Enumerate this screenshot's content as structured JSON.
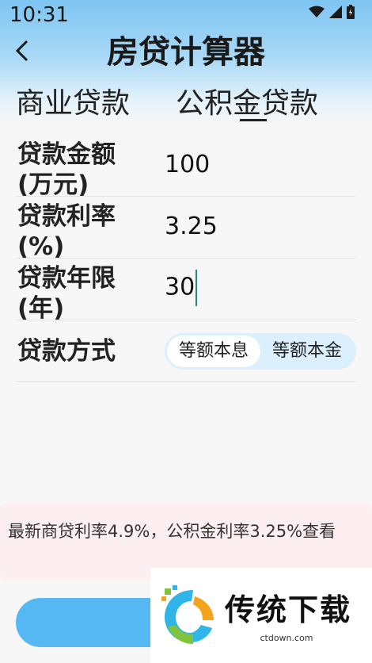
{
  "status_bar": {
    "time": "10:31"
  },
  "nav": {
    "title": "房贷计算器"
  },
  "tabs": [
    {
      "label": "商业贷款"
    },
    {
      "label": "公积金贷款"
    }
  ],
  "form": {
    "amount": {
      "label": "贷款金额(万元)",
      "value": "100"
    },
    "rate": {
      "label": "贷款利率(%)",
      "value": "3.25"
    },
    "years": {
      "label": "贷款年限(年)",
      "value": "30"
    },
    "method": {
      "label": "贷款方式",
      "options": [
        "等额本息",
        "等额本金"
      ],
      "selected": "等额本息"
    }
  },
  "notice": {
    "text": "最新商贷利率4.9%，公积金利率3.25%查看"
  },
  "watermark": {
    "brand": "传统下载",
    "url": "ctdown.com"
  },
  "colors": {
    "accent": "#55b8f2",
    "header_top": "#7ec5f2",
    "notice_bg": "#fdeef2",
    "cursor": "#1e8c86"
  }
}
